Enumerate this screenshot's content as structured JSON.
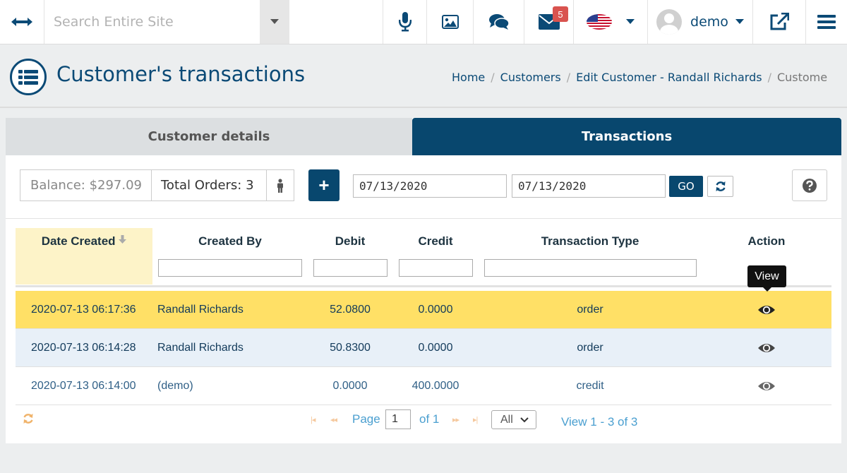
{
  "topbar": {
    "search_placeholder": "Search Entire Site",
    "mail_badge": "5",
    "user_name": "demo",
    "icons": [
      "expand-icon",
      "chevron-down-icon",
      "microphone-icon",
      "image-icon",
      "comments-icon",
      "envelope-icon",
      "us-flag-icon",
      "avatar",
      "external-link-icon",
      "menu-icon"
    ]
  },
  "header": {
    "title": "Customer's transactions",
    "breadcrumb": [
      "Home",
      "Customers",
      "Edit Customer - Randall Richards",
      "Customer's transactions"
    ]
  },
  "tabs": [
    {
      "label": "Customer details",
      "active": false
    },
    {
      "label": "Transactions",
      "active": true
    }
  ],
  "toolbar": {
    "balance": "Balance: $297.09",
    "total_orders": "Total Orders: 3",
    "add_label": "+",
    "date_from": "07/13/2020",
    "date_to": "07/13/2020",
    "go_label": "GO"
  },
  "table": {
    "columns": [
      "Date Created",
      "Created By",
      "Debit",
      "Credit",
      "Transaction Type",
      "Action"
    ],
    "sorted_column": "Date Created",
    "rows": [
      {
        "date": "2020-07-13 06:17:36",
        "created_by": "Randall Richards",
        "debit": "52.0800",
        "credit": "0.0000",
        "type": "order"
      },
      {
        "date": "2020-07-13 06:14:28",
        "created_by": "Randall Richards",
        "debit": "50.8300",
        "credit": "0.0000",
        "type": "order"
      },
      {
        "date": "2020-07-13 06:14:00",
        "created_by": "(demo)",
        "debit": "0.0000",
        "credit": "400.0000",
        "type": "credit"
      }
    ],
    "tooltip": "View"
  },
  "pager": {
    "page_label": "Page",
    "page_value": "1",
    "of_label": "of 1",
    "rows_select": "All",
    "view_info": "View 1 - 3 of 3"
  },
  "colors": {
    "brand": "#08476e",
    "highlight_row": "#ffe066",
    "alt_row": "#e8f0f8",
    "badge": "#d9534f",
    "link": "#4a9fd0"
  }
}
